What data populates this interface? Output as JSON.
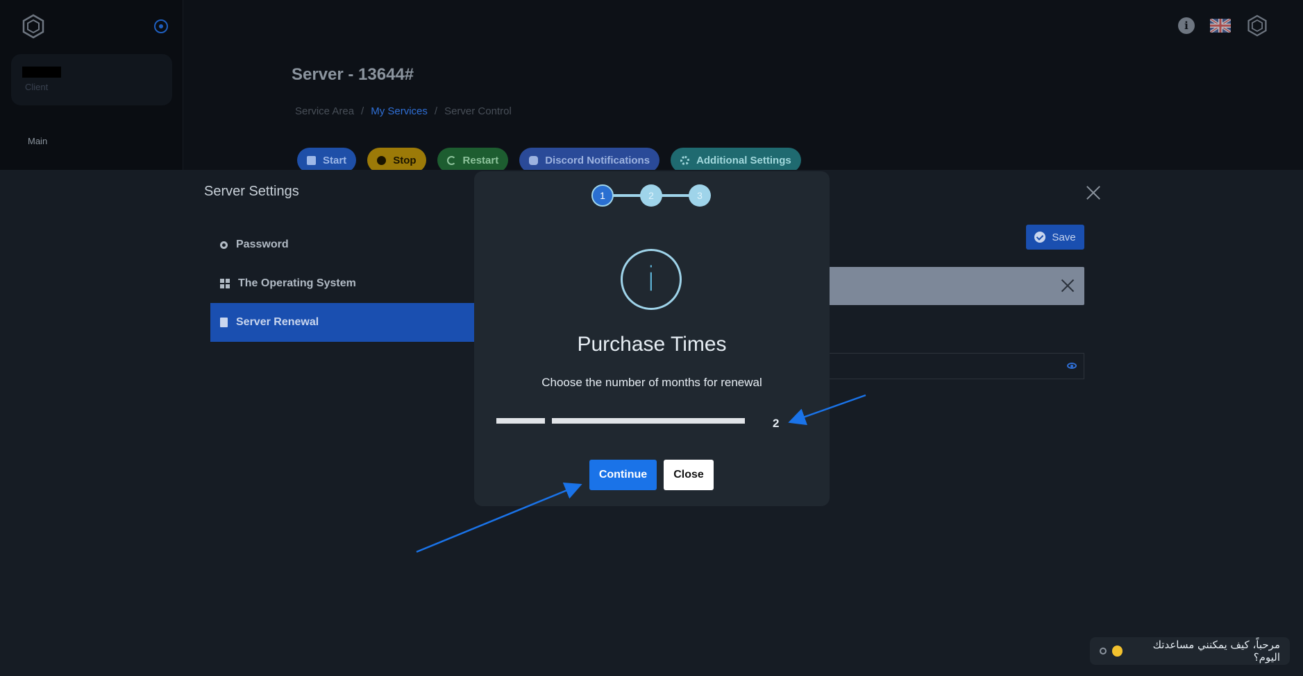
{
  "sidebar": {
    "user_role": "Client",
    "section_label": "Main"
  },
  "page": {
    "title": "Server - 13644#",
    "breadcrumb": [
      {
        "label": "Service Area",
        "sep": "/"
      },
      {
        "label": "My Services",
        "sep": "/"
      },
      {
        "label": "Server Control"
      }
    ]
  },
  "actions": {
    "start": "Start",
    "stop": "Stop",
    "restart": "Restart",
    "discord": "Discord Notifications",
    "additional": "Additional Settings"
  },
  "settings": {
    "title": "Server Settings",
    "menu": [
      {
        "label": "Password",
        "icon": "key-icon"
      },
      {
        "label": "The Operating System",
        "icon": "windows-icon"
      },
      {
        "label": "Server Renewal",
        "icon": "document-icon",
        "active": true
      }
    ],
    "save_label": "Save"
  },
  "modal": {
    "steps": [
      "1",
      "2",
      "3"
    ],
    "current_step": 1,
    "icon": "info-icon",
    "title": "Purchase Times",
    "description": "Choose the number of months for renewal",
    "slider_value": "2",
    "continue_label": "Continue",
    "close_label": "Close"
  },
  "chat": {
    "message": "مرحباً، كيف يمكنني مساعدتك اليوم؟"
  },
  "colors": {
    "accent": "#1a73e8",
    "active_menu": "#1a4fb0",
    "step_light": "#9fd4ea",
    "annotation_arrow": "#1a73e8"
  }
}
